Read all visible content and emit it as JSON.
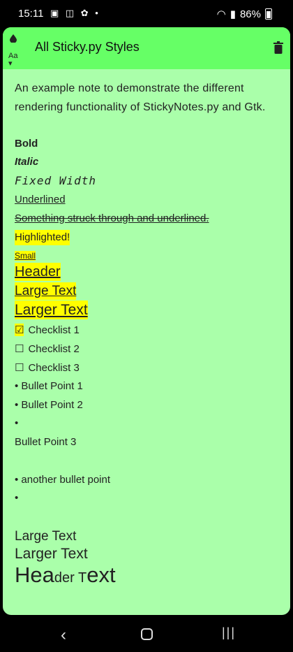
{
  "status": {
    "time": "15:11",
    "left_icons": "▣ ◫ ✿ •",
    "battery": "86%"
  },
  "toolbar": {
    "title": "All Sticky.py Styles",
    "icons": [
      "drop-icon",
      "font-size-icon",
      "trash-icon"
    ]
  },
  "note": {
    "intro": "An example note to demonstrate the different rendering functionality of StickyNotes.py and Gtk.",
    "bold": "Bold",
    "italic": "Italic",
    "fixed": "Fixed Width",
    "underlined": "Underlined",
    "strike": "Something struck through and underlined.",
    "highlighted": "Highlighted!",
    "small": "Small",
    "header": "Header",
    "large": "Large Text",
    "larger": "Larger Text",
    "checklist": [
      {
        "checked": true,
        "label": "Checklist 1"
      },
      {
        "checked": false,
        "label": "Checklist 2"
      },
      {
        "checked": false,
        "label": "Checklist 3"
      }
    ],
    "bullets": [
      "Bullet Point 1",
      "Bullet Point 2",
      ""
    ],
    "bullet3": "Bullet Point 3",
    "bullets2": [
      "another bullet point",
      ""
    ],
    "large_plain": "Large Text",
    "larger_plain": "Larger Text",
    "header_mixed": {
      "part1": "Hea",
      "part2": "der T",
      "part3": "ext"
    }
  }
}
